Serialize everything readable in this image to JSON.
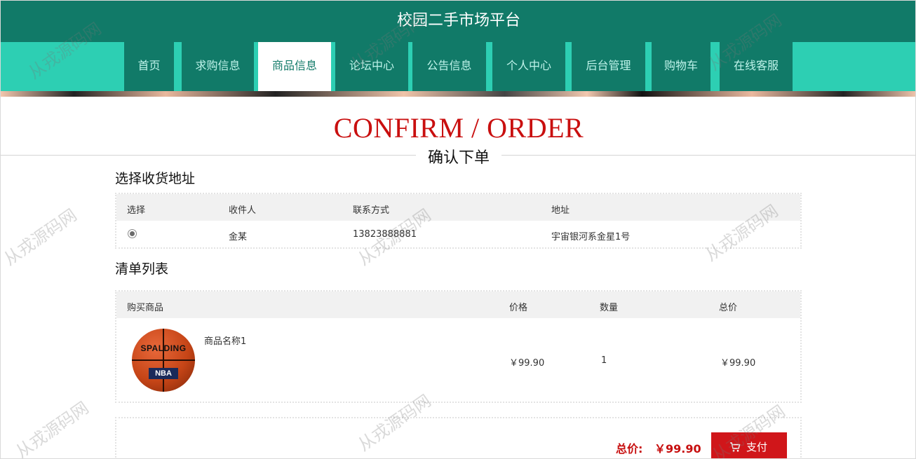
{
  "header": {
    "site_title": "校园二手市场平台"
  },
  "nav": {
    "items": [
      {
        "label": "首页",
        "active": false
      },
      {
        "label": "求购信息",
        "active": false
      },
      {
        "label": "商品信息",
        "active": true
      },
      {
        "label": "论坛中心",
        "active": false
      },
      {
        "label": "公告信息",
        "active": false
      },
      {
        "label": "个人中心",
        "active": false
      },
      {
        "label": "后台管理",
        "active": false
      },
      {
        "label": "购物车",
        "active": false
      },
      {
        "label": "在线客服",
        "active": false
      }
    ]
  },
  "page": {
    "heading_en": "CONFIRM / ORDER",
    "heading_cn": "确认下单"
  },
  "address_section": {
    "title": "选择收货地址",
    "columns": [
      "选择",
      "收件人",
      "联系方式",
      "地址"
    ],
    "rows": [
      {
        "selected": true,
        "recipient": "金某",
        "phone": "13823888881",
        "address": "宇宙银河系金星1号"
      }
    ]
  },
  "items_section": {
    "title": "清单列表",
    "columns": [
      "购买商品",
      "价格",
      "数量",
      "总价"
    ],
    "rows": [
      {
        "image_icon": "basketball-image",
        "image_logo_text": "SPALDING",
        "image_badge_text": "NBA",
        "name": "商品名称1",
        "price": "￥99.90",
        "quantity": "1",
        "subtotal": "￥99.90"
      }
    ]
  },
  "summary": {
    "total_label": "总价:",
    "total_value": "￥99.90",
    "pay_label": "支付",
    "pay_icon": "cart-icon"
  },
  "watermark": {
    "text": "从戎源码网"
  },
  "colors": {
    "header": "#117a68",
    "nav_bar": "#2dcfb3",
    "accent_red": "#c90f0f",
    "pay_button": "#d0161a"
  }
}
